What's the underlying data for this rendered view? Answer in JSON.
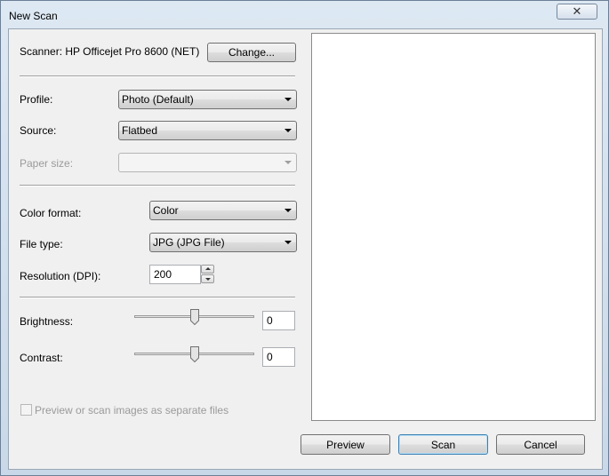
{
  "window": {
    "title": "New Scan",
    "close_glyph": "✕"
  },
  "scanner": {
    "label": "Scanner: HP Officejet Pro 8600 (NET)",
    "change_label": "Change..."
  },
  "profile": {
    "label": "Profile:",
    "value": "Photo (Default)"
  },
  "source": {
    "label": "Source:",
    "value": "Flatbed"
  },
  "paper_size": {
    "label": "Paper size:",
    "value": ""
  },
  "color_format": {
    "label": "Color format:",
    "value": "Color"
  },
  "file_type": {
    "label": "File type:",
    "value": "JPG (JPG File)"
  },
  "resolution": {
    "label": "Resolution (DPI):",
    "value": "200"
  },
  "brightness": {
    "label": "Brightness:",
    "value": "0",
    "level": 0.5
  },
  "contrast": {
    "label": "Contrast:",
    "value": "0",
    "level": 0.5
  },
  "separate_files": {
    "label": "Preview or scan images as separate files",
    "checked": false
  },
  "buttons": {
    "preview": "Preview",
    "scan": "Scan",
    "cancel": "Cancel"
  },
  "icons": {
    "close": "close-icon",
    "dropdown": "chevron-down-icon"
  },
  "colors": {
    "default_button_border": "#3c7fb1",
    "disabled_text": "#9a9a9a"
  }
}
